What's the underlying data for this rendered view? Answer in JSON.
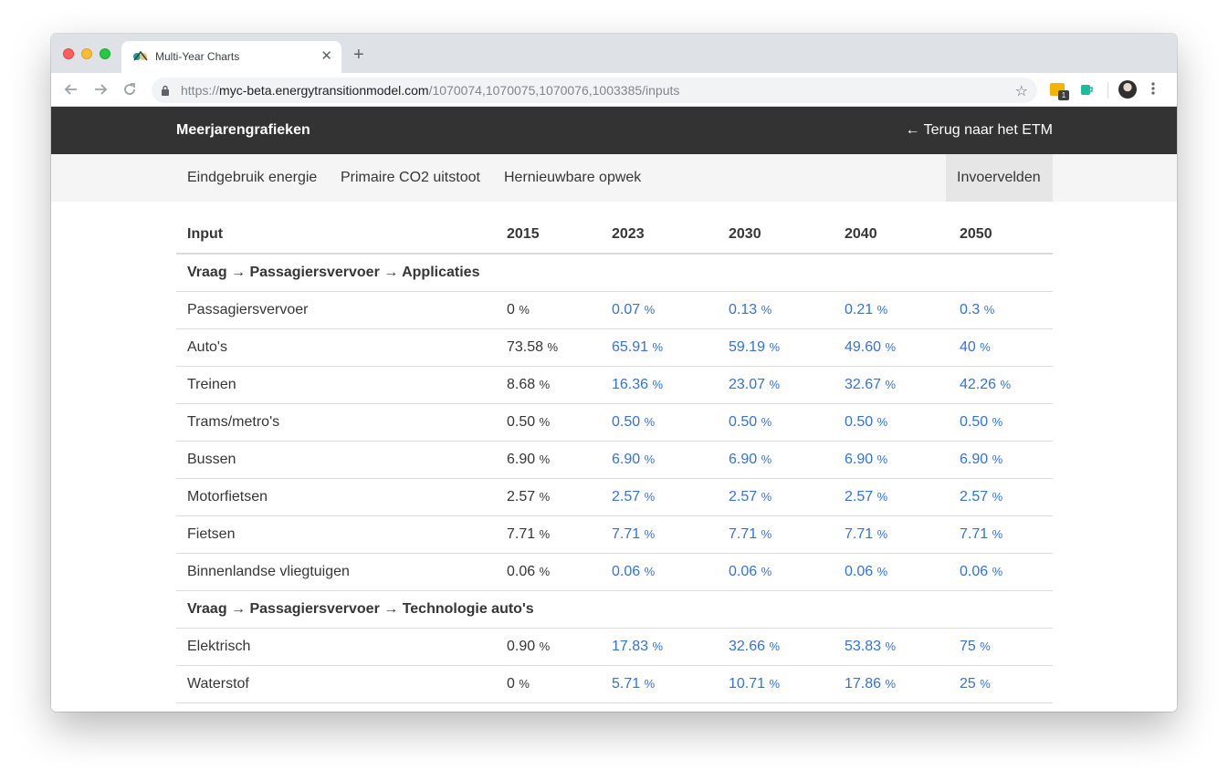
{
  "browser": {
    "tab_title": "Multi-Year Charts",
    "url_scheme": "https://",
    "url_host": "myc-beta.energytransitionmodel.com",
    "url_path": "/1070074,1070075,1070076,1003385/inputs",
    "extension_badge": "1"
  },
  "navbar": {
    "brand": "Meerjarengrafieken",
    "back_link": "← Terug naar het ETM"
  },
  "subnav": {
    "items": [
      {
        "label": "Eindgebruik energie"
      },
      {
        "label": "Primaire CO2 uitstoot"
      },
      {
        "label": "Hernieuwbare opwek"
      },
      {
        "label": "Invoervelden",
        "active": true
      }
    ]
  },
  "table": {
    "headers": [
      "Input",
      "2015",
      "2023",
      "2030",
      "2040",
      "2050"
    ],
    "unit": "%",
    "rows": [
      {
        "section": "Vraag → Passagiersvervoer → Applicaties"
      },
      {
        "label": "Passagiersvervoer",
        "values": [
          "0",
          "0.07",
          "0.13",
          "0.21",
          "0.3"
        ]
      },
      {
        "label": "Auto's",
        "values": [
          "73.58",
          "65.91",
          "59.19",
          "49.60",
          "40"
        ]
      },
      {
        "label": "Treinen",
        "values": [
          "8.68",
          "16.36",
          "23.07",
          "32.67",
          "42.26"
        ]
      },
      {
        "label": "Trams/metro's",
        "values": [
          "0.50",
          "0.50",
          "0.50",
          "0.50",
          "0.50"
        ]
      },
      {
        "label": "Bussen",
        "values": [
          "6.90",
          "6.90",
          "6.90",
          "6.90",
          "6.90"
        ]
      },
      {
        "label": "Motorfietsen",
        "values": [
          "2.57",
          "2.57",
          "2.57",
          "2.57",
          "2.57"
        ]
      },
      {
        "label": "Fietsen",
        "values": [
          "7.71",
          "7.71",
          "7.71",
          "7.71",
          "7.71"
        ]
      },
      {
        "label": "Binnenlandse vliegtuigen",
        "values": [
          "0.06",
          "0.06",
          "0.06",
          "0.06",
          "0.06"
        ]
      },
      {
        "section": "Vraag → Passagiersvervoer → Technologie auto's"
      },
      {
        "label": "Elektrisch",
        "values": [
          "0.90",
          "17.83",
          "32.66",
          "53.83",
          "75"
        ]
      },
      {
        "label": "Waterstof",
        "values": [
          "0",
          "5.71",
          "10.71",
          "17.86",
          "25"
        ]
      }
    ]
  },
  "colors": {
    "navbar_bg": "#333333",
    "future_value": "#3273dc",
    "text": "#363636"
  }
}
